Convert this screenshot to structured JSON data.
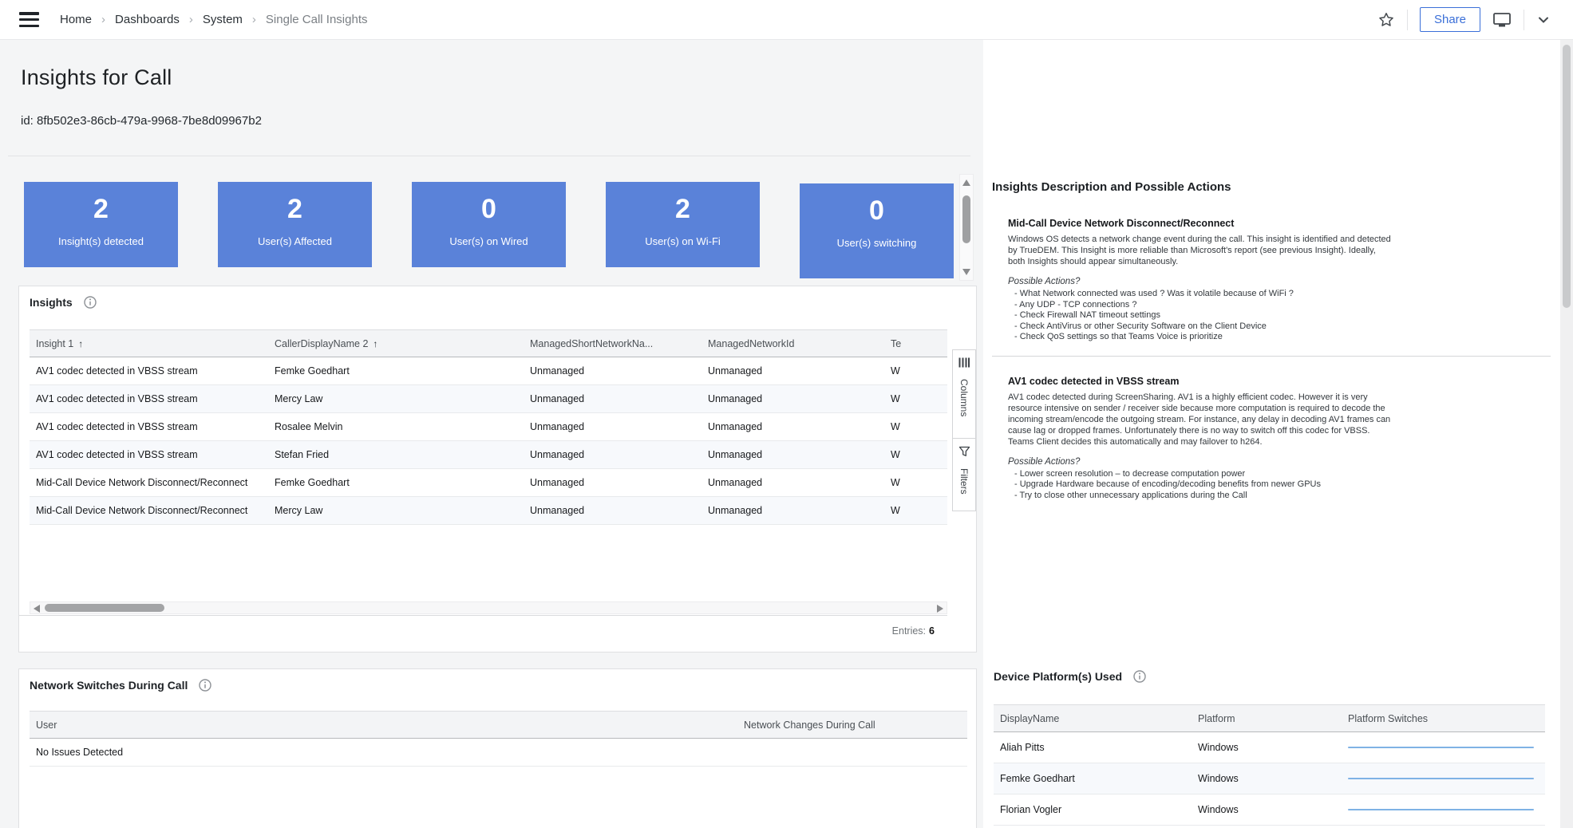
{
  "colors": {
    "accent_blue": "#5a82d9",
    "share_blue": "#3a6fd8",
    "sparkline_blue": "#7fb2e5"
  },
  "navbar": {
    "breadcrumb": {
      "items": [
        "Home",
        "Dashboards",
        "System",
        "Single Call Insights"
      ],
      "separator": "›"
    },
    "share_label": "Share"
  },
  "header": {
    "title": "Insights for Call",
    "call_id": "id: 8fb502e3-86cb-479a-9968-7be8d09967b2"
  },
  "stat_cards": [
    {
      "value": "2",
      "label": "Insight(s) detected"
    },
    {
      "value": "2",
      "label": "User(s) Affected"
    },
    {
      "value": "0",
      "label": "User(s) on Wired"
    },
    {
      "value": "2",
      "label": "User(s) on Wi-Fi"
    },
    {
      "value": "0",
      "label": "User(s) switching"
    }
  ],
  "insights": {
    "title": "Insights",
    "columns": [
      {
        "label": "Insight 1",
        "sort": "↑"
      },
      {
        "label": "CallerDisplayName 2",
        "sort": "↑"
      },
      {
        "label": "ManagedShortNetworkNa...",
        "sort": ""
      },
      {
        "label": "ManagedNetworkId",
        "sort": ""
      },
      {
        "label": "Te",
        "sort": ""
      }
    ],
    "rows": [
      [
        "AV1 codec detected in VBSS stream",
        "Femke Goedhart",
        "Unmanaged",
        "Unmanaged",
        "W"
      ],
      [
        "AV1 codec detected in VBSS stream",
        "Mercy Law",
        "Unmanaged",
        "Unmanaged",
        "W"
      ],
      [
        "AV1 codec detected in VBSS stream",
        "Rosalee Melvin",
        "Unmanaged",
        "Unmanaged",
        "W"
      ],
      [
        "AV1 codec detected in VBSS stream",
        "Stefan Fried",
        "Unmanaged",
        "Unmanaged",
        "W"
      ],
      [
        "Mid-Call Device Network Disconnect/Reconnect",
        "Femke Goedhart",
        "Unmanaged",
        "Unmanaged",
        "W"
      ],
      [
        "Mid-Call Device Network Disconnect/Reconnect",
        "Mercy Law",
        "Unmanaged",
        "Unmanaged",
        "W"
      ]
    ],
    "tools": [
      {
        "label": "Columns"
      },
      {
        "label": "Filters"
      }
    ],
    "entries_label": "Entries:",
    "entries_value": "6"
  },
  "description": {
    "title": "Insights Description and Possible Actions",
    "sections": [
      {
        "heading": "Mid-Call Device Network Disconnect/Reconnect",
        "body": "Windows OS detects a network change event during the call. This insight is identified and detected by TrueDEM. This Insight is more reliable than Microsoft's report (see previous Insight). Ideally, both Insights should appear simultaneously.",
        "actions_label": "Possible Actions?",
        "actions": [
          "- What Network connected was used ? Was it volatile because of WiFi ?",
          "- Any UDP - TCP connections ?",
          "- Check Firewall NAT timeout settings",
          "- Check AntiVirus or other Security Software on the Client Device",
          "- Check QoS settings so that Teams Voice is prioritize"
        ]
      },
      {
        "heading": "AV1 codec detected in VBSS stream",
        "body": "AV1 codec detected during ScreenSharing. AV1 is a highly efficient codec. However it is very resource intensive on sender / receiver side because more computation is required to decode the incoming stream/encode the outgoing stream. For instance, any delay in decoding AV1 frames can cause lag or dropped frames. Unfortunately there is no way to switch off this codec for VBSS. Teams Client decides this automatically and may failover to h264.",
        "actions_label": "Possible Actions?",
        "actions": [
          "- Lower screen resolution – to decrease computation power",
          "- Upgrade Hardware because of encoding/decoding benefits from newer GPUs",
          "- Try to close other unnecessary applications during the Call"
        ]
      }
    ]
  },
  "network": {
    "title": "Network Switches During Call",
    "columns": [
      "User",
      "Network Changes During Call"
    ],
    "rows": [
      [
        "No Issues Detected",
        ""
      ]
    ]
  },
  "devices": {
    "title": "Device Platform(s) Used",
    "columns": [
      "DisplayName",
      "Platform",
      "Platform Switches"
    ],
    "rows": [
      {
        "name": "Aliah Pitts",
        "platform": "Windows"
      },
      {
        "name": "Femke Goedhart",
        "platform": "Windows"
      },
      {
        "name": "Florian Vogler",
        "platform": "Windows"
      }
    ]
  }
}
